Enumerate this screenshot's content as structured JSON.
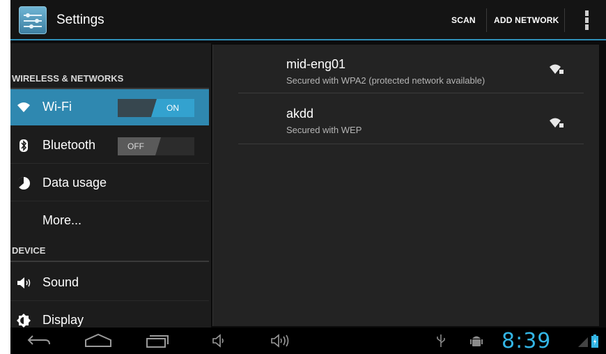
{
  "action_bar": {
    "title": "Settings",
    "scan_label": "SCAN",
    "add_network_label": "ADD NETWORK"
  },
  "sidebar": {
    "sections": [
      {
        "label": "WIRELESS & NETWORKS"
      },
      {
        "label": "DEVICE"
      }
    ],
    "items": [
      {
        "label": "Wi-Fi",
        "icon": "wifi-icon",
        "toggle": "ON",
        "selected": true
      },
      {
        "label": "Bluetooth",
        "icon": "bluetooth-icon",
        "toggle": "OFF"
      },
      {
        "label": "Data usage",
        "icon": "data-usage-icon"
      },
      {
        "label": "More..."
      },
      {
        "label": "Sound",
        "icon": "speaker-icon"
      },
      {
        "label": "Display",
        "icon": "display-icon"
      }
    ]
  },
  "networks": [
    {
      "ssid": "mid-eng01",
      "security": "Secured with WPA2 (protected network available)",
      "icon": "wifi-lock-icon"
    },
    {
      "ssid": "akdd",
      "security": "Secured with WEP",
      "icon": "wifi-lock-icon"
    }
  ],
  "status_bar": {
    "time": "8:39"
  },
  "colors": {
    "accent": "#33b5e5",
    "selected_item": "#2f88b0",
    "background": "#0b0b0b"
  }
}
